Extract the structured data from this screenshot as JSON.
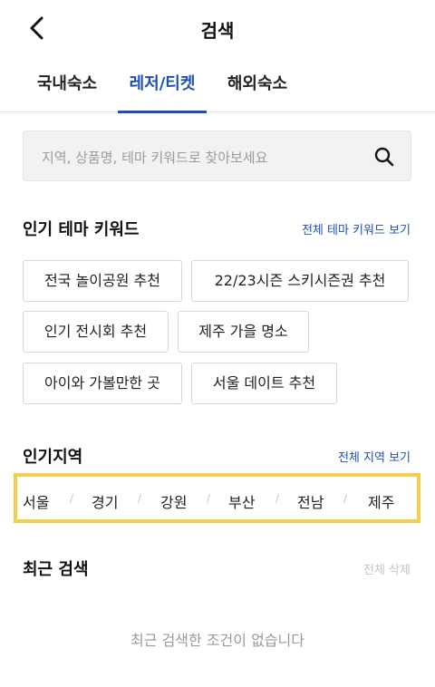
{
  "header": {
    "title": "검색"
  },
  "tabs": [
    {
      "label": "국내숙소"
    },
    {
      "label": "레저/티켓"
    },
    {
      "label": "해외숙소"
    }
  ],
  "active_tab": "레저/티켓",
  "search": {
    "placeholder": "지역, 상품명, 테마 키워드로 찾아보세요"
  },
  "theme_keywords": {
    "title": "인기 테마 키워드",
    "link": "전체 테마 키워드 보기",
    "chips": [
      "전국 놀이공원 추천",
      "22/23시즌 스키시즌권 추천",
      "인기 전시회 추천",
      "제주 가을 명소",
      "아이와 가볼만한 곳",
      "서울 데이트 추천"
    ]
  },
  "regions": {
    "title": "인기지역",
    "link": "전체 지역 보기",
    "items": [
      "서울",
      "경기",
      "강원",
      "부산",
      "전남",
      "제주"
    ],
    "separator": "/"
  },
  "recent": {
    "title": "최근 검색",
    "clear_label": "전체 삭제",
    "empty_text": "최근 검색한 조건이 없습니다"
  },
  "colors": {
    "accent": "#1e50b4",
    "highlight_border": "#f4cf4f",
    "search_bg": "#f2f2f4"
  },
  "icons": {
    "back": "chevron-left-icon",
    "search": "search-icon"
  }
}
